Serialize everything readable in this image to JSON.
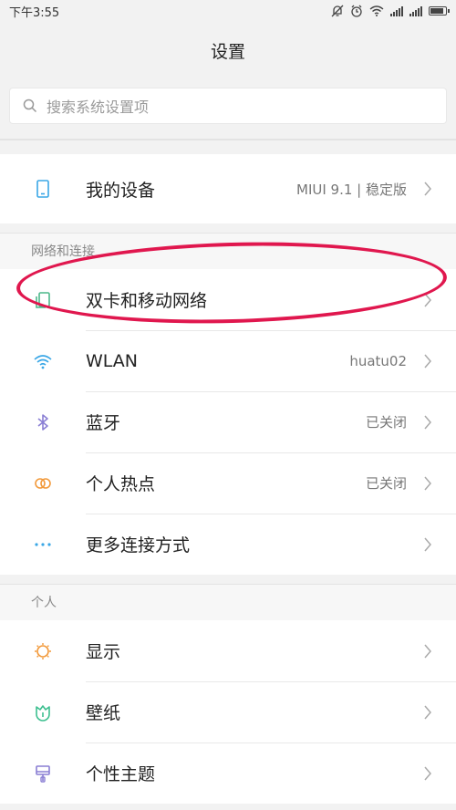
{
  "status_bar": {
    "time": "下午3:55"
  },
  "header": {
    "title": "设置"
  },
  "search": {
    "placeholder": "搜索系统设置项"
  },
  "device": {
    "label": "我的设备",
    "value": "MIUI 9.1 | 稳定版"
  },
  "network": {
    "header": "网络和连接",
    "items": [
      {
        "label": "双卡和移动网络",
        "value": "",
        "icon": "dual-sim-icon"
      },
      {
        "label": "WLAN",
        "value": "huatu02",
        "icon": "wifi-icon"
      },
      {
        "label": "蓝牙",
        "value": "已关闭",
        "icon": "bluetooth-icon"
      },
      {
        "label": "个人热点",
        "value": "已关闭",
        "icon": "hotspot-icon"
      },
      {
        "label": "更多连接方式",
        "value": "",
        "icon": "more-icon"
      }
    ]
  },
  "personal": {
    "header": "个人",
    "items": [
      {
        "label": "显示",
        "icon": "display-icon"
      },
      {
        "label": "壁纸",
        "icon": "wallpaper-icon"
      },
      {
        "label": "个性主题",
        "icon": "theme-icon"
      }
    ]
  },
  "colors": {
    "accent": "#3aa7e6",
    "annotation": "#e0174e"
  }
}
